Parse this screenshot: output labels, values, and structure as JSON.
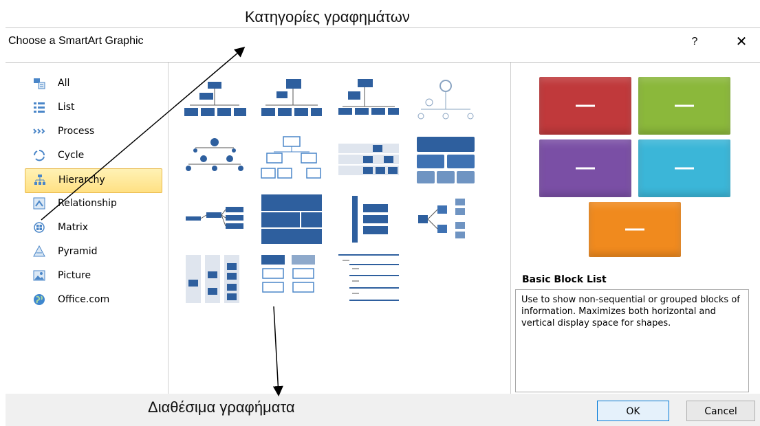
{
  "annotations": {
    "categories_label": "Κατηγορίες γραφημάτων",
    "available_label": "Διαθέσιμα γραφήματα"
  },
  "dialog": {
    "title": "Choose a SmartArt Graphic",
    "help_label": "?",
    "close_label": "✕"
  },
  "categories": [
    {
      "label": "All",
      "icon": "all-icon"
    },
    {
      "label": "List",
      "icon": "list-icon"
    },
    {
      "label": "Process",
      "icon": "process-icon"
    },
    {
      "label": "Cycle",
      "icon": "cycle-icon"
    },
    {
      "label": "Hierarchy",
      "icon": "hierarchy-icon",
      "selected": true
    },
    {
      "label": "Relationship",
      "icon": "relationship-icon"
    },
    {
      "label": "Matrix",
      "icon": "matrix-icon"
    },
    {
      "label": "Pyramid",
      "icon": "pyramid-icon"
    },
    {
      "label": "Picture",
      "icon": "picture-icon"
    },
    {
      "label": "Office.com",
      "icon": "globe-icon"
    }
  ],
  "preview": {
    "title": "Basic Block List",
    "description": "Use to show non-sequential or grouped blocks of information. Maximizes both horizontal and vertical display space for shapes.",
    "colors": [
      "#c0393b",
      "#8bb83b",
      "#7a4fa5",
      "#3bb6d8",
      "#f08a1e"
    ]
  },
  "buttons": {
    "ok": "OK",
    "cancel": "Cancel"
  }
}
